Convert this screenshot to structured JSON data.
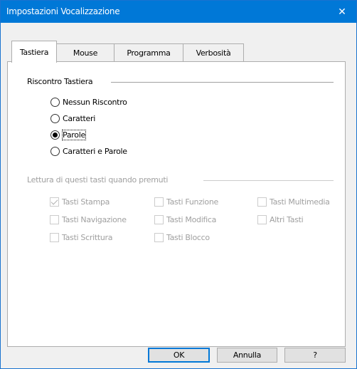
{
  "window": {
    "title": "Impostazioni Vocalizzazione",
    "close_glyph": "✕"
  },
  "tabs": [
    {
      "label": "Tastiera",
      "active": true
    },
    {
      "label": "Mouse",
      "active": false
    },
    {
      "label": "Programma",
      "active": false
    },
    {
      "label": "Verbosità",
      "active": false
    }
  ],
  "keyboard_feedback": {
    "title": "Riscontro Tastiera",
    "options": [
      {
        "label": "Nessun Riscontro",
        "checked": false
      },
      {
        "label": "Caratteri",
        "checked": false
      },
      {
        "label": "Parole",
        "checked": true
      },
      {
        "label": "Caratteri e Parole",
        "checked": false
      }
    ]
  },
  "keys_reading": {
    "title": "Lettura di questi tasti quando premuti",
    "enabled": false,
    "items": [
      {
        "label": "Tasti Stampa",
        "checked": true
      },
      {
        "label": "Tasti Funzione",
        "checked": false
      },
      {
        "label": "Tasti Multimedia",
        "checked": false
      },
      {
        "label": "Tasti Navigazione",
        "checked": false
      },
      {
        "label": "Tasti Modifica",
        "checked": false
      },
      {
        "label": "Altri Tasti",
        "checked": false
      },
      {
        "label": "Tasti Scrittura",
        "checked": false
      },
      {
        "label": "Tasti Blocco",
        "checked": false
      }
    ]
  },
  "buttons": {
    "ok": "OK",
    "cancel": "Annulla",
    "help": "?"
  },
  "colors": {
    "titlebar": "#0078d7",
    "default_button_border": "#0078d7"
  }
}
